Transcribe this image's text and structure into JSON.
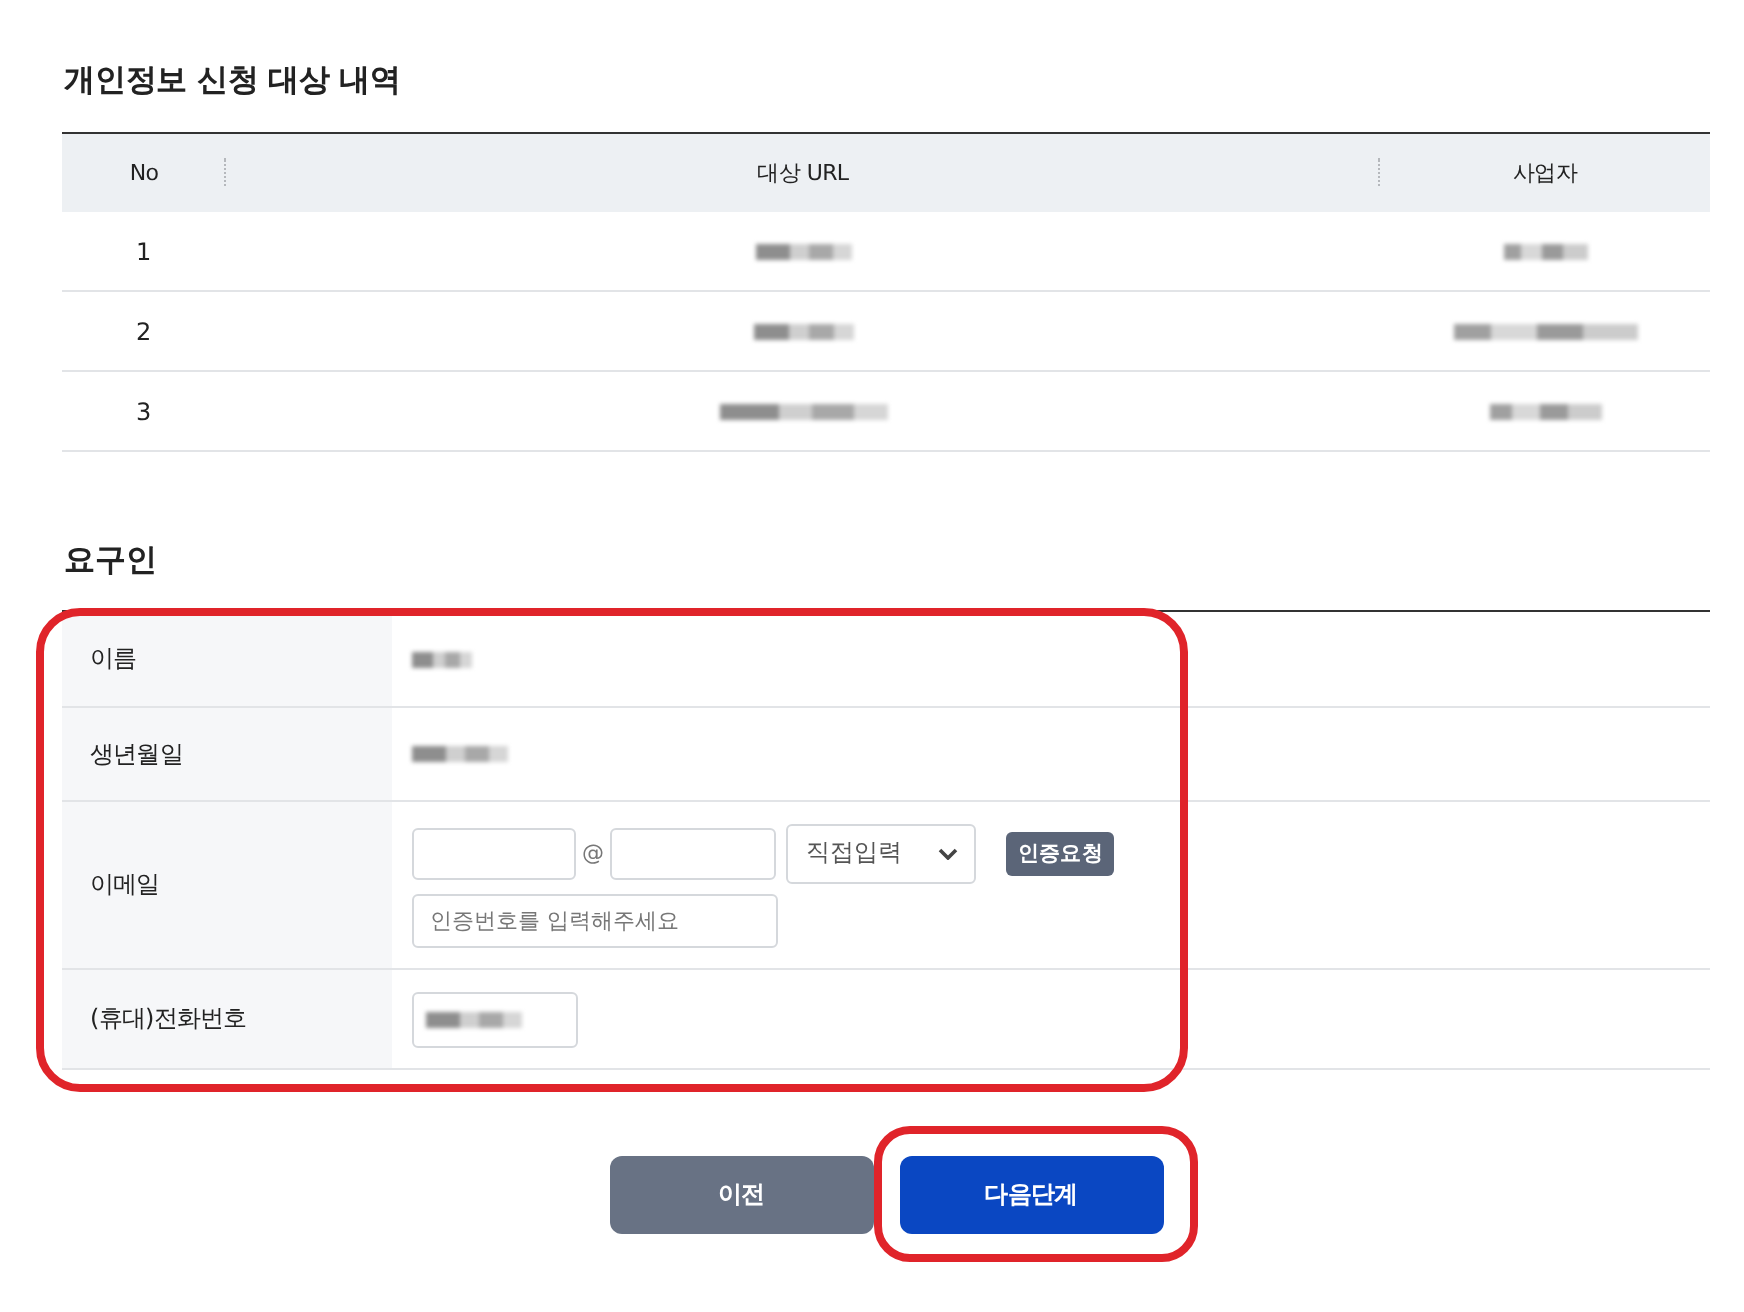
{
  "section_title": "개인정보 신청 대상 내역",
  "targets": {
    "columns": [
      "No",
      "대상 URL",
      "사업자"
    ],
    "rows": [
      {
        "no": "1",
        "url_redacted": true,
        "company_redacted": true
      },
      {
        "no": "2",
        "url_redacted": true,
        "company_redacted": true
      },
      {
        "no": "3",
        "url_redacted": true,
        "company_redacted": true
      }
    ]
  },
  "applicant": {
    "title": "요구인",
    "highlighted": true,
    "fields": [
      {
        "kind": "text",
        "label": "이름",
        "redacted": true
      },
      {
        "kind": "text",
        "label": "생년월일",
        "redacted": true
      },
      {
        "kind": "email",
        "label": "이메일",
        "at_sign": "@",
        "domain_select": "직접입력",
        "request_button": "인증요청",
        "code_placeholder": "인증번호를 입력해주세요"
      },
      {
        "kind": "phone",
        "label": "(휴대)전화번호",
        "redacted": true
      }
    ]
  },
  "buttons": [
    {
      "label": "이전",
      "kind": "secondary",
      "highlighted": false
    },
    {
      "label": "다음단계",
      "kind": "primary",
      "highlighted": true
    }
  ]
}
